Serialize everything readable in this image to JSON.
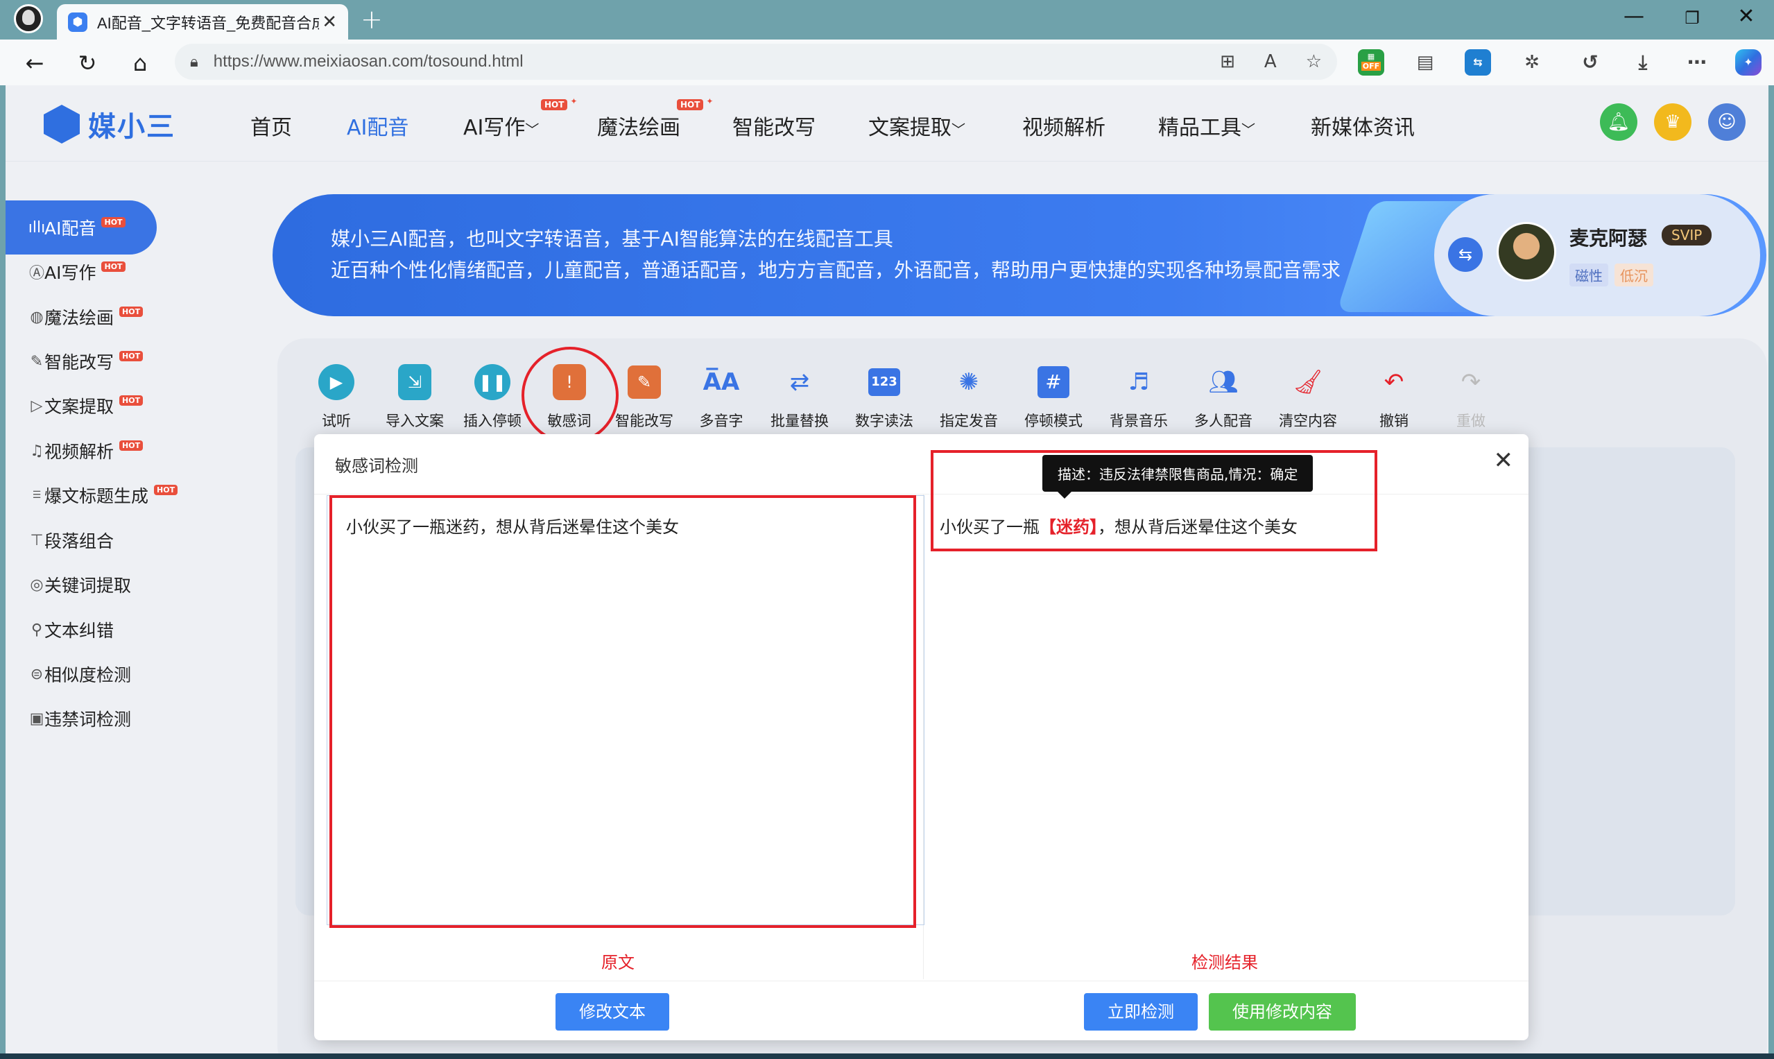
{
  "browser": {
    "tab_title": "AI配音_文字转语音_免费配音合成",
    "url": "https://www.meixiaosan.com/tosound.html",
    "ext_off_label": "OFF"
  },
  "site": {
    "logo_text": "媒小三",
    "nav": [
      {
        "label": "首页",
        "active": false,
        "hot": false
      },
      {
        "label": "AI配音",
        "active": true,
        "hot": false
      },
      {
        "label": "AI写作",
        "active": false,
        "hot": true,
        "dropdown": true
      },
      {
        "label": "魔法绘画",
        "active": false,
        "hot": true
      },
      {
        "label": "智能改写",
        "active": false,
        "hot": false
      },
      {
        "label": "文案提取",
        "active": false,
        "hot": false,
        "dropdown": true
      },
      {
        "label": "视频解析",
        "active": false,
        "hot": false
      },
      {
        "label": "精品工具",
        "active": false,
        "hot": false,
        "dropdown": true
      },
      {
        "label": "新媒体资讯",
        "active": false,
        "hot": false
      }
    ],
    "hot_label": "HOT",
    "sidebar": [
      {
        "label": "AI配音",
        "icon": "sound-wave-icon",
        "hot": true,
        "active": true
      },
      {
        "label": "AI写作",
        "icon": "ai-write-icon",
        "hot": true
      },
      {
        "label": "魔法绘画",
        "icon": "palette-icon",
        "hot": true
      },
      {
        "label": "智能改写",
        "icon": "edit-icon",
        "hot": true
      },
      {
        "label": "文案提取",
        "icon": "play-doc-icon",
        "hot": true
      },
      {
        "label": "视频解析",
        "icon": "video-parse-icon",
        "hot": true
      },
      {
        "label": "爆文标题生成",
        "icon": "title-icon",
        "hot": true
      },
      {
        "label": "段落组合",
        "icon": "paragraph-icon",
        "hot": false
      },
      {
        "label": "关键词提取",
        "icon": "keyword-icon",
        "hot": false
      },
      {
        "label": "文本纠错",
        "icon": "correct-icon",
        "hot": false
      },
      {
        "label": "相似度检测",
        "icon": "similarity-icon",
        "hot": false
      },
      {
        "label": "违禁词检测",
        "icon": "forbidden-icon",
        "hot": false
      }
    ],
    "banner": {
      "line1": "媒小三AI配音，也叫文字转语音，基于AI智能算法的在线配音工具",
      "line2": "近百种个性化情绪配音，儿童配音，普通话配音，地方方言配音，外语配音，帮助用户更快捷的实现各种场景配音需求"
    },
    "voice": {
      "name": "麦克阿瑟",
      "badge": "SVIP",
      "tags": [
        "磁性",
        "低沉"
      ]
    },
    "toolbar": [
      {
        "label": "试听",
        "icon": "play-icon",
        "color": "#2aa6c8"
      },
      {
        "label": "导入文案",
        "icon": "import-doc-icon",
        "color": "#2aa6c8"
      },
      {
        "label": "插入停顿",
        "icon": "pause-icon",
        "color": "#2aa6c8"
      },
      {
        "label": "敏感词",
        "icon": "sensitive-icon",
        "color": "#e0703a"
      },
      {
        "label": "智能改写",
        "icon": "rewrite-icon",
        "color": "#e0703a"
      },
      {
        "label": "多音字",
        "icon": "polyphone-icon",
        "color": "#3a74e4"
      },
      {
        "label": "批量替换",
        "icon": "replace-icon",
        "color": "#3a74e4"
      },
      {
        "label": "数字读法",
        "icon": "number-icon",
        "color": "#3a74e4"
      },
      {
        "label": "指定发音",
        "icon": "pronounce-icon",
        "color": "#3a74e4"
      },
      {
        "label": "停顿模式",
        "icon": "hash-icon",
        "color": "#3a74e4"
      },
      {
        "label": "背景音乐",
        "icon": "music-icon",
        "color": "#3a74e4"
      },
      {
        "label": "多人配音",
        "icon": "users-icon",
        "color": "#3a74e4"
      },
      {
        "label": "清空内容",
        "icon": "broom-icon",
        "color": "#e5212a"
      },
      {
        "label": "撤销",
        "icon": "undo-icon",
        "color": "#e5212a"
      },
      {
        "label": "重做",
        "icon": "redo-icon",
        "color": "#bbbbbb"
      }
    ]
  },
  "dialog": {
    "title": "敏感词检测",
    "original_text": "小伙买了一瓶迷药，想从背后迷晕住这个美女",
    "result_before": "小伙买了一瓶",
    "result_highlight": "【迷药】",
    "result_after": "，想从背后迷晕住这个美女",
    "tooltip": "描述：违反法律禁限售商品,情况：确定",
    "label_original": "原文",
    "label_result": "检测结果",
    "btn_modify": "修改文本",
    "btn_detect": "立即检测",
    "btn_use": "使用修改内容"
  }
}
